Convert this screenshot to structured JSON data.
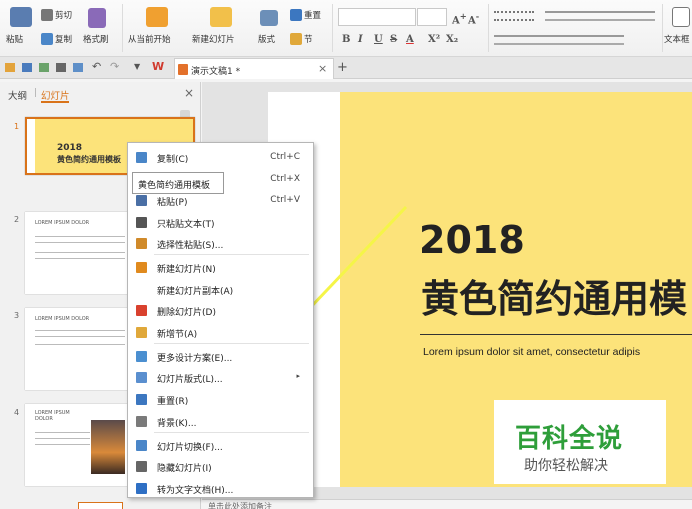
{
  "ribbon": {
    "paste": "粘贴",
    "cut": "剪切",
    "copy": "复制",
    "format_painter": "格式刷",
    "from_start": "从当前开始",
    "new_slide": "新建幻灯片",
    "layout": "版式",
    "reset": "重置",
    "section": "节",
    "text_box": "文本框",
    "font_buttons": [
      "B",
      "I",
      "U",
      "S",
      "A",
      "X²",
      "X₂"
    ]
  },
  "tabs": {
    "doc_title": "演示文稿1 *",
    "close": "×",
    "new": "+"
  },
  "panel": {
    "tab_outline": "大纲",
    "tab_slides": "幻灯片",
    "close": "×"
  },
  "thumbnails": [
    {
      "num": "1",
      "year": "2018",
      "title": "黄色简约通用模板"
    },
    {
      "num": "2",
      "heading": "LOREM IPSUM DOLOR"
    },
    {
      "num": "3",
      "heading": "LOREM IPSUM DOLOR"
    },
    {
      "num": "4",
      "heading": "LOREM IPSUM DOLOR"
    }
  ],
  "tooltip": "黄色简约通用模板",
  "context_menu": [
    {
      "label": "复制(C)",
      "shortcut": "Ctrl+C",
      "icon": "copy-icon",
      "color": "#4a86c8"
    },
    {
      "label": "剪切(T)",
      "shortcut": "Ctrl+X",
      "icon": "scissors-icon",
      "color": "#666"
    },
    {
      "label": "粘贴(P)",
      "shortcut": "Ctrl+V",
      "icon": "paste-icon",
      "color": "#4a6fa5"
    },
    {
      "label": "只粘贴文本(T)",
      "shortcut": "",
      "icon": "paste-text-icon",
      "color": "#555"
    },
    {
      "label": "选择性粘贴(S)...",
      "shortcut": "",
      "icon": "paste-special-icon",
      "color": "#d08a2a"
    },
    {
      "label": "新建幻灯片(N)",
      "shortcut": "",
      "icon": "new-slide-icon",
      "color": "#e08a1e"
    },
    {
      "label": "新建幻灯片副本(A)",
      "shortcut": "",
      "icon": "",
      "color": ""
    },
    {
      "label": "删除幻灯片(D)",
      "shortcut": "",
      "icon": "delete-slide-icon",
      "color": "#d9412e"
    },
    {
      "label": "新增节(A)",
      "shortcut": "",
      "icon": "new-section-icon",
      "color": "#e0a83a"
    },
    {
      "label": "更多设计方案(E)...",
      "shortcut": "",
      "icon": "design-icon",
      "color": "#4b8fd0"
    },
    {
      "label": "幻灯片版式(L)...",
      "shortcut": "",
      "icon": "layout-icon",
      "color": "#5a8fcf"
    },
    {
      "label": "重置(R)",
      "shortcut": "",
      "icon": "reset-icon",
      "color": "#3c77c0"
    },
    {
      "label": "背景(K)...",
      "shortcut": "",
      "icon": "background-icon",
      "color": "#7a7a7a"
    },
    {
      "label": "幻灯片切换(F)...",
      "shortcut": "",
      "icon": "transition-icon",
      "color": "#4a86c8"
    },
    {
      "label": "隐藏幻灯片(I)",
      "shortcut": "",
      "icon": "hide-slide-icon",
      "color": "#666"
    },
    {
      "label": "转为文字文档(H)...",
      "shortcut": "",
      "icon": "to-word-icon",
      "color": "#2e6fc4"
    }
  ],
  "slide": {
    "year": "2018",
    "title": "黄色简约通用模",
    "subtitle": "Lorem ipsum dolor sit amet, consectetur adipis"
  },
  "watermark": {
    "title": "百科全说",
    "subtitle": "助你轻松解决"
  },
  "status": {
    "notes": "单击此处添加备注"
  },
  "colors": {
    "accent": "#e8a31a",
    "slide_bg": "#fce37a",
    "watermark_green": "#2e9e3a",
    "arrow": "#f5f548"
  }
}
